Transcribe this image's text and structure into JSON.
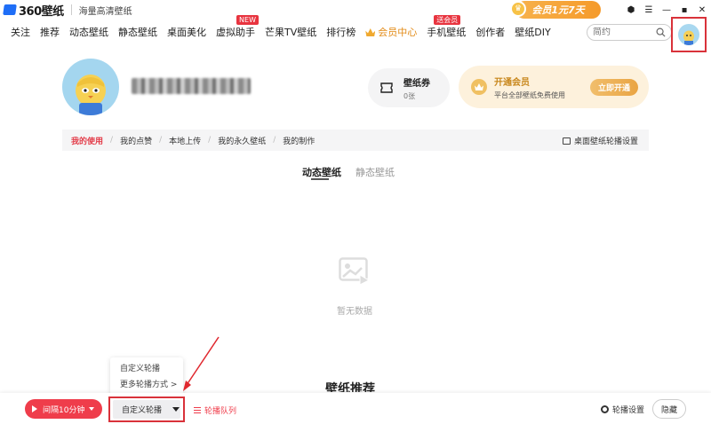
{
  "app": {
    "logo_text": "360壁纸",
    "slogan": "海量高清壁纸",
    "promo": "会员1元7天"
  },
  "nav": {
    "items": [
      {
        "label": "关注"
      },
      {
        "label": "推荐"
      },
      {
        "label": "动态壁纸"
      },
      {
        "label": "静态壁纸"
      },
      {
        "label": "桌面美化"
      },
      {
        "label": "虚拟助手",
        "badge": "NEW"
      },
      {
        "label": "芒果TV壁纸"
      },
      {
        "label": "排行榜"
      },
      {
        "label": "会员中心"
      },
      {
        "label": "手机壁纸",
        "badge": "送会员"
      },
      {
        "label": "创作者"
      },
      {
        "label": "壁纸DIY"
      }
    ]
  },
  "search": {
    "placeholder": "简约"
  },
  "profile": {
    "coupon": {
      "title": "壁纸券",
      "count": "0张"
    },
    "vip": {
      "title": "开通会员",
      "subtitle": "平台全部壁纸免费使用",
      "button": "立即开通"
    }
  },
  "tabs": {
    "items": [
      {
        "label": "我的使用"
      },
      {
        "label": "我的点赞"
      },
      {
        "label": "本地上传"
      },
      {
        "label": "我的永久壁纸"
      },
      {
        "label": "我的制作"
      }
    ],
    "carousel_setting": "桌面壁纸轮播设置"
  },
  "subtabs": {
    "active": "动态壁纸",
    "inactive": "静态壁纸"
  },
  "empty": {
    "text": "暂无数据"
  },
  "popup": {
    "items": [
      "自定义轮播",
      "更多轮播方式 >"
    ]
  },
  "recommend_title": "壁纸推荐",
  "bottombar": {
    "interval": "间隔10分钟",
    "mode": "自定义轮播",
    "queue": "轮播队列",
    "settings": "轮播设置",
    "hide": "隐藏"
  },
  "colors": {
    "accent_red": "#ef3d4b",
    "vip_gold": "#e9a443",
    "highlight_box": "#d9323a"
  }
}
